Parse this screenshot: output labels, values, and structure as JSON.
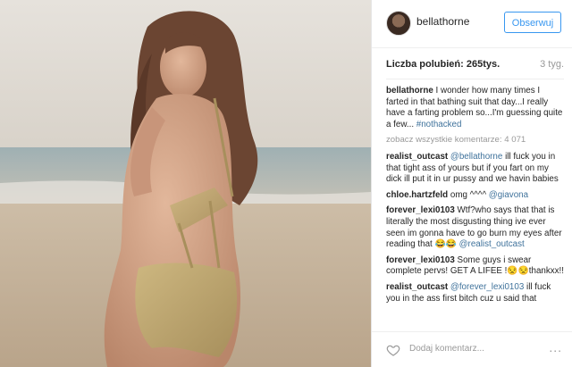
{
  "header": {
    "username": "bellathorne",
    "follow_label": "Obserwuj"
  },
  "stats": {
    "likes_label": "Liczba polubień:",
    "likes_count": "265tys.",
    "time_ago": "3 tyg."
  },
  "caption": {
    "user": "bellathorne",
    "text": "I wonder how many times I farted in that bathing suit that day...I really have a farting problem so...I'm guessing quite a few...",
    "hashtag": "#nothacked"
  },
  "see_all": "zobacz wszystkie komentarze: 4 071",
  "comments": [
    {
      "user": "realist_outcast",
      "mention": "@bellathorne",
      "text": "ill fuck you in that tight ass of yours but if you fart on my dick ill put it in ur pussy and we havin babies"
    },
    {
      "user": "chloe.hartzfeld",
      "text": "omg ^^^^",
      "mention": "@giavona"
    },
    {
      "user": "forever_lexi0103",
      "text": "Wtf?who says that that is literally the most disgusting thing ive ever seen im gonna have to go burn my eyes after reading that 😂😂",
      "mention": "@realist_outcast"
    },
    {
      "user": "forever_lexi0103",
      "text": "Some guys i swear complete pervs! GET A LIFEE !😒😒thankxx!!"
    },
    {
      "user": "realist_outcast",
      "mention": "@forever_lexi0103",
      "text": "ill fuck you in the ass first bitch cuz u said that"
    }
  ],
  "footer": {
    "add_comment_placeholder": "Dodaj komentarz...",
    "more_label": "..."
  },
  "colors": {
    "link": "#3f729b",
    "follow_blue": "#3897f0",
    "muted": "#999999"
  },
  "icons": [
    "heart-icon",
    "more-options-icon",
    "avatar"
  ]
}
